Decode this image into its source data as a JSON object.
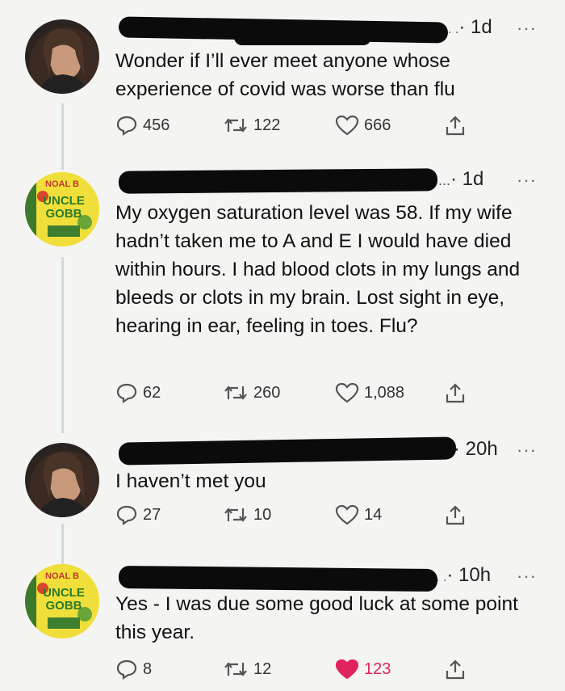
{
  "tweets": [
    {
      "time": "· 1d",
      "time_prefix": ". .",
      "more": "···",
      "text": "Wonder if I’ll ever meet anyone whose experience of covid was worse than flu",
      "avatar": "person",
      "replies": "456",
      "retweets": "122",
      "likes": "666",
      "liked": false
    },
    {
      "time": "· 1d",
      "time_prefix": "...",
      "more": "···",
      "text": "My oxygen saturation level was 58. If my wife hadn’t taken me to A and E I would have died within hours. I had blood clots in my lungs and bleeds or clots in my brain. Lost sight in eye, hearing in ear, feeling in toes. Flu?",
      "avatar": "book",
      "replies": "62",
      "retweets": "260",
      "likes": "1,088",
      "liked": false
    },
    {
      "time": "· 20h",
      "time_prefix": "",
      "more": "···",
      "text": "I haven’t met you",
      "avatar": "person",
      "replies": "27",
      "retweets": "10",
      "likes": "14",
      "liked": false
    },
    {
      "time": "· 10h",
      "time_prefix": ". .",
      "more": "···",
      "text": "Yes -  I was due some good luck at some point this year.",
      "avatar": "book",
      "replies": "8",
      "retweets": "12",
      "likes": "123",
      "liked": true
    }
  ],
  "avatar_book_text": {
    "top": "NOAL B",
    "title_line1": "UNCLE",
    "title_line2": "GOBB"
  },
  "colors": {
    "like_active": "#e0245e",
    "icon": "#555555",
    "thread_line": "#cfd9de"
  },
  "icons": [
    "reply-icon",
    "retweet-icon",
    "like-icon",
    "share-icon",
    "more-icon"
  ]
}
